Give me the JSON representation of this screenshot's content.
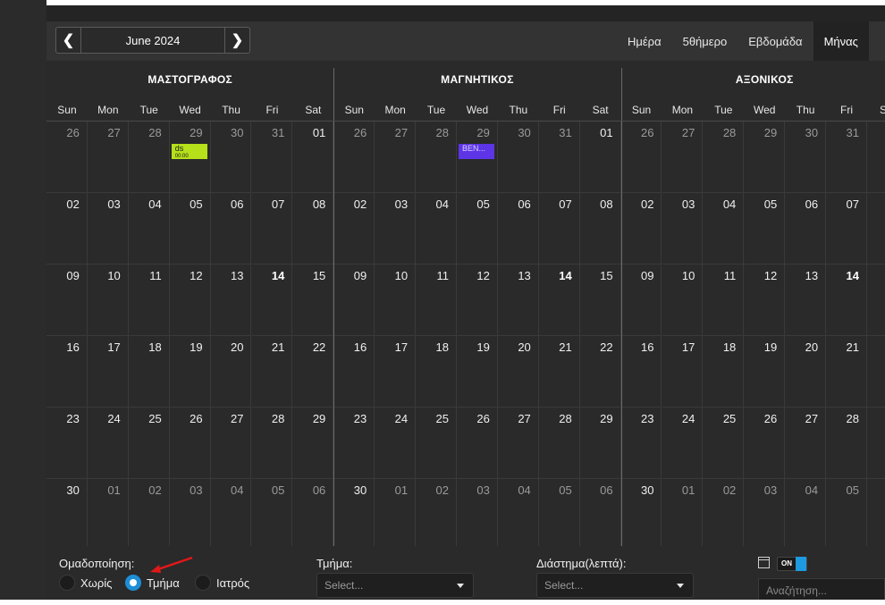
{
  "nav": {
    "prev_symbol": "❮",
    "next_symbol": "❯",
    "title": "June 2024"
  },
  "views": [
    {
      "label": "Ημέρα",
      "active": false
    },
    {
      "label": "5θήμερο",
      "active": false
    },
    {
      "label": "Εβδομάδα",
      "active": false
    },
    {
      "label": "Μήνας",
      "active": true
    }
  ],
  "groups": [
    {
      "name": "ΜΑΣΤΟΓΡΑΦΟΣ"
    },
    {
      "name": "ΜΑΓΝΗΤΙΚΟΣ"
    },
    {
      "name": "ΑΞΟΝΙΚΟΣ"
    }
  ],
  "weekdays": [
    "Sun",
    "Mon",
    "Tue",
    "Wed",
    "Thu",
    "Fri",
    "Sat"
  ],
  "weeks": [
    [
      "26",
      "27",
      "28",
      "29",
      "30",
      "31",
      "01"
    ],
    [
      "02",
      "03",
      "04",
      "05",
      "06",
      "07",
      "08"
    ],
    [
      "09",
      "10",
      "11",
      "12",
      "13",
      "14",
      "15"
    ],
    [
      "16",
      "17",
      "18",
      "19",
      "20",
      "21",
      "22"
    ],
    [
      "23",
      "24",
      "25",
      "26",
      "27",
      "28",
      "29"
    ],
    [
      "30",
      "01",
      "02",
      "03",
      "04",
      "05",
      "06"
    ]
  ],
  "today": "14",
  "events": [
    {
      "group": 0,
      "week": 0,
      "day": 3,
      "label": "ds",
      "sublabel": "00:00",
      "color": "#b6e01a",
      "text_color": "#1a1a1a"
    },
    {
      "group": 1,
      "week": 0,
      "day": 3,
      "label": "BEN...",
      "sublabel": "",
      "color": "#5d35e6",
      "text_color": "#d8d0ff"
    }
  ],
  "colors": {
    "today_weight": "bold",
    "dim_text": "#9a9a9a",
    "accent": "#1d8fd6"
  },
  "bottom": {
    "grouping_label": "Ομαδοποίηση:",
    "grouping_options": [
      {
        "label": "Χωρίς",
        "checked": false
      },
      {
        "label": "Τμήμα",
        "checked": true
      },
      {
        "label": "Ιατρός",
        "checked": false
      }
    ],
    "department_label": "Τμήμα:",
    "department_placeholder": "Select...",
    "interval_label": "Διάστημα(λεπτά):",
    "interval_placeholder": "Select...",
    "toggle_label": "ON",
    "search_placeholder": "Αναζήτηση..."
  }
}
